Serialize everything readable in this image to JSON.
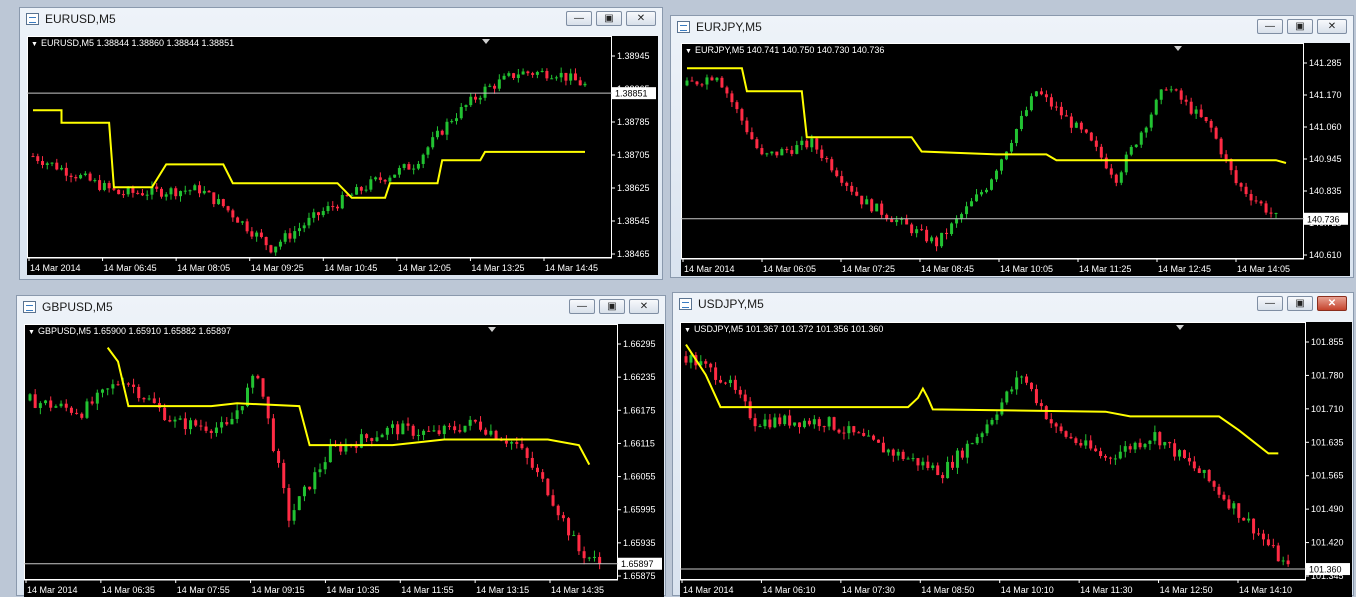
{
  "windows": [
    {
      "id": "eurusd",
      "title": "EURUSD,M5",
      "header": "EURUSD,M5  1.38844 1.38860 1.38844 1.38851",
      "active": false,
      "price_labels": [
        "1.38945",
        "1.38865",
        "1.38785",
        "1.38705",
        "1.38625",
        "1.38545",
        "1.38465"
      ],
      "price_min": 1.38465,
      "price_max": 1.38945,
      "current_price": "1.38851",
      "current_value": 1.38851,
      "time_labels": [
        "14 Mar 2014",
        "14 Mar 06:45",
        "14 Mar 08:05",
        "14 Mar 09:25",
        "14 Mar 10:45",
        "14 Mar 12:05",
        "14 Mar 13:25",
        "14 Mar 14:45"
      ],
      "anchors": [
        [
          0,
          1.387
        ],
        [
          18,
          1.3861
        ],
        [
          35,
          1.3862
        ],
        [
          40,
          1.3858
        ],
        [
          50,
          1.3848
        ],
        [
          60,
          1.3856
        ],
        [
          72,
          1.3864
        ],
        [
          80,
          1.3868
        ],
        [
          88,
          1.3879
        ],
        [
          95,
          1.3886
        ],
        [
          102,
          1.389
        ],
        [
          110,
          1.389
        ],
        [
          116,
          1.3887
        ]
      ],
      "yellow": [
        [
          0,
          1.3881
        ],
        [
          6,
          1.3881
        ],
        [
          6,
          1.3878
        ],
        [
          16,
          1.3878
        ],
        [
          17,
          1.38625
        ],
        [
          25,
          1.38625
        ],
        [
          28,
          1.3868
        ],
        [
          40,
          1.3868
        ],
        [
          42,
          1.38635
        ],
        [
          64,
          1.38635
        ],
        [
          67,
          1.386
        ],
        [
          74,
          1.386
        ],
        [
          75,
          1.38635
        ],
        [
          85,
          1.38635
        ],
        [
          86,
          1.3869
        ],
        [
          94,
          1.3869
        ],
        [
          95,
          1.3871
        ],
        [
          116,
          1.3871
        ]
      ],
      "candles": 120
    },
    {
      "id": "eurjpy",
      "title": "EURJPY,M5",
      "header": "EURJPY,M5  140.741 140.750 140.730 140.736",
      "active": false,
      "price_labels": [
        "141.285",
        "141.170",
        "141.060",
        "140.945",
        "140.835",
        "140.725",
        "140.610"
      ],
      "price_min": 140.61,
      "price_max": 141.285,
      "current_price": "140.736",
      "current_value": 140.736,
      "time_labels": [
        "14 Mar 2014",
        "14 Mar 06:05",
        "14 Mar 07:25",
        "14 Mar 08:45",
        "14 Mar 10:05",
        "14 Mar 11:25",
        "14 Mar 12:45",
        "14 Mar 14:05"
      ],
      "anchors": [
        [
          0,
          141.2
        ],
        [
          6,
          141.24
        ],
        [
          15,
          140.95
        ],
        [
          25,
          141.0
        ],
        [
          35,
          140.8
        ],
        [
          50,
          140.65
        ],
        [
          60,
          140.85
        ],
        [
          70,
          141.18
        ],
        [
          80,
          141.02
        ],
        [
          86,
          140.88
        ],
        [
          96,
          141.2
        ],
        [
          105,
          141.05
        ],
        [
          110,
          140.86
        ],
        [
          118,
          140.74
        ]
      ],
      "yellow": [
        [
          0,
          141.26
        ],
        [
          11,
          141.26
        ],
        [
          12,
          141.18
        ],
        [
          23,
          141.18
        ],
        [
          24,
          141.02
        ],
        [
          38,
          141.02
        ],
        [
          45,
          141.02
        ],
        [
          47,
          140.97
        ],
        [
          62,
          140.96
        ],
        [
          72,
          140.96
        ],
        [
          74,
          140.94
        ],
        [
          88,
          140.94
        ],
        [
          118,
          140.94
        ],
        [
          120,
          140.93
        ]
      ],
      "candles": 122
    },
    {
      "id": "gbpusd",
      "title": "GBPUSD,M5",
      "header": "GBPUSD,M5  1.65900 1.65910 1.65882 1.65897",
      "active": false,
      "price_labels": [
        "1.66295",
        "1.66235",
        "1.66175",
        "1.66115",
        "1.66055",
        "1.65995",
        "1.65935",
        "1.65875"
      ],
      "price_min": 1.65875,
      "price_max": 1.66295,
      "current_price": "1.65897",
      "current_value": 1.65897,
      "time_labels": [
        "14 Mar 2014",
        "14 Mar 06:35",
        "14 Mar 07:55",
        "14 Mar 09:15",
        "14 Mar 10:35",
        "14 Mar 11:55",
        "14 Mar 13:15",
        "14 Mar 14:35"
      ],
      "anchors": [
        [
          0,
          1.6619
        ],
        [
          10,
          1.6617
        ],
        [
          18,
          1.6623
        ],
        [
          28,
          1.6615
        ],
        [
          38,
          1.6614
        ],
        [
          44,
          1.6624
        ],
        [
          50,
          1.6598
        ],
        [
          58,
          1.661
        ],
        [
          70,
          1.6614
        ],
        [
          78,
          1.6613
        ],
        [
          86,
          1.6615
        ],
        [
          94,
          1.6611
        ],
        [
          100,
          1.6603
        ],
        [
          106,
          1.6592
        ],
        [
          110,
          1.65897
        ]
      ],
      "yellow": [
        [
          15,
          1.66285
        ],
        [
          17,
          1.6626
        ],
        [
          19,
          1.6618
        ],
        [
          35,
          1.6618
        ],
        [
          40,
          1.66185
        ],
        [
          52,
          1.6618
        ],
        [
          54,
          1.6611
        ],
        [
          70,
          1.6611
        ],
        [
          80,
          1.6612
        ],
        [
          100,
          1.6612
        ],
        [
          106,
          1.6611
        ],
        [
          108,
          1.66075
        ]
      ],
      "candles": 112
    },
    {
      "id": "usdjpy",
      "title": "USDJPY,M5",
      "header": "USDJPY,M5  101.367 101.372 101.356 101.360",
      "active": true,
      "price_labels": [
        "101.855",
        "101.780",
        "101.710",
        "101.635",
        "101.565",
        "101.490",
        "101.420",
        "101.345"
      ],
      "price_min": 101.345,
      "price_max": 101.855,
      "current_price": "101.360",
      "current_value": 101.36,
      "time_labels": [
        "14 Mar 2014",
        "14 Mar 06:10",
        "14 Mar 07:30",
        "14 Mar 08:50",
        "14 Mar 10:10",
        "14 Mar 11:30",
        "14 Mar 12:50",
        "14 Mar 14:10"
      ],
      "anchors": [
        [
          0,
          101.82
        ],
        [
          8,
          101.77
        ],
        [
          14,
          101.68
        ],
        [
          28,
          101.68
        ],
        [
          40,
          101.62
        ],
        [
          52,
          101.57
        ],
        [
          60,
          101.66
        ],
        [
          68,
          101.78
        ],
        [
          75,
          101.66
        ],
        [
          85,
          101.6
        ],
        [
          95,
          101.65
        ],
        [
          105,
          101.56
        ],
        [
          115,
          101.45
        ],
        [
          122,
          101.36
        ]
      ],
      "yellow": [
        [
          0,
          101.845
        ],
        [
          4,
          101.78
        ],
        [
          7,
          101.71
        ],
        [
          45,
          101.71
        ],
        [
          47,
          101.73
        ],
        [
          48,
          101.75
        ],
        [
          49,
          101.73
        ],
        [
          50,
          101.705
        ],
        [
          85,
          101.7
        ],
        [
          90,
          101.69
        ],
        [
          108,
          101.69
        ],
        [
          112,
          101.66
        ],
        [
          115,
          101.635
        ],
        [
          118,
          101.61
        ],
        [
          120,
          101.61
        ]
      ],
      "candles": 124
    }
  ]
}
